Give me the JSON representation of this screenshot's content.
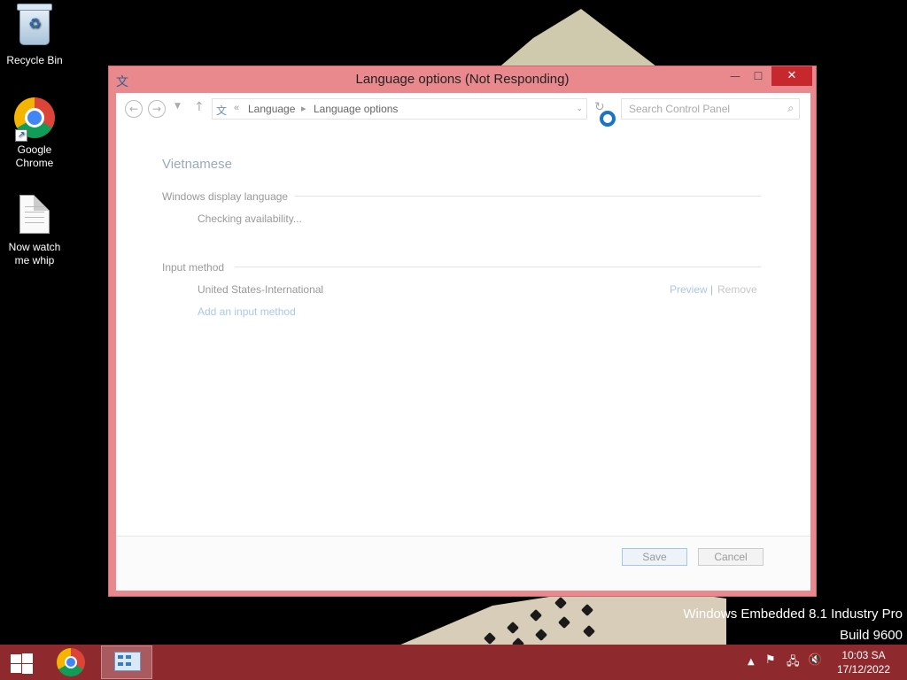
{
  "desktop": {
    "icons": [
      {
        "label": "Recycle Bin",
        "icon": "recycle-bin-icon"
      },
      {
        "label": "Google Chrome",
        "icon": "chrome-icon"
      },
      {
        "label": "Now watch me whip",
        "icon": "text-document-icon"
      }
    ],
    "watermark": {
      "line1": "Windows Embedded 8.1 Industry Pro",
      "line2": "Build 9600"
    }
  },
  "window": {
    "title": "Language options (Not Responding)",
    "controls": {
      "minimize": "—",
      "maximize": "☐",
      "close": "✕"
    },
    "nav": {
      "breadcrumb": [
        "Language",
        "Language options"
      ],
      "breadcrumb_prefix": "«",
      "search_placeholder": "Search Control Panel"
    },
    "content": {
      "language": "Vietnamese",
      "display_section": "Windows display language",
      "display_status": "Checking availability...",
      "input_section": "Input method",
      "input_methods": [
        {
          "name": "United States-International",
          "preview": "Preview",
          "separator": "|",
          "remove": "Remove"
        }
      ],
      "add_input_method": "Add an input method"
    },
    "footer": {
      "save": "Save",
      "cancel": "Cancel"
    }
  },
  "taskbar": {
    "clock_time": "10:03 SA",
    "clock_date": "17/12/2022",
    "tray_icons": [
      "show-hidden-icons-icon",
      "action-center-flag-icon",
      "network-icon",
      "volume-muted-icon"
    ]
  },
  "colors": {
    "window_frame": "#e9898e",
    "close_button": "#c7282e",
    "taskbar": "#8e2a2e",
    "link": "#a9c8e6",
    "heading": "#9aa9bc"
  }
}
